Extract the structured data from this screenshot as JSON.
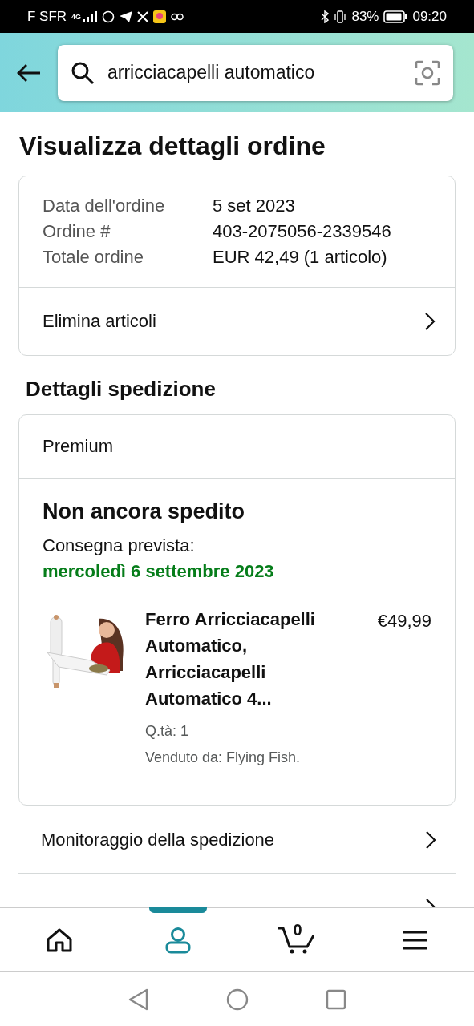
{
  "status_bar": {
    "carrier": "F SFR",
    "network": "4G",
    "battery": "83%",
    "time": "09:20"
  },
  "search": {
    "value": "arricciacapelli automatico"
  },
  "title": "Visualizza dettagli ordine",
  "order": {
    "fields": [
      {
        "label": "Data dell'ordine",
        "value": "5 set 2023"
      },
      {
        "label": "Ordine #",
        "value": "403-2075056-2339546"
      },
      {
        "label": "Totale ordine",
        "value": "EUR 42,49 (1 articolo)"
      }
    ],
    "action": "Elimina articoli"
  },
  "shipping": {
    "heading": "Dettagli spedizione",
    "service": "Premium",
    "status": "Non ancora spedito",
    "delivery_label": "Consegna prevista:",
    "delivery_date": "mercoledì 6 settembre 2023",
    "item": {
      "kind": "picture",
      "name": "Ferro Arricciacapelli Automatico, Arricciacapelli Automatico 4...",
      "price": "€49,99",
      "quantity": "Q.tà: 1",
      "seller": "Venduto da: Flying Fish."
    }
  },
  "links": [
    "Monitoraggio della spedizione"
  ],
  "bottom_nav": [
    {
      "kind": "home",
      "selected": false
    },
    {
      "kind": "account",
      "selected": true
    },
    {
      "kind": "cart",
      "selected": false,
      "count": "0"
    },
    {
      "kind": "menu",
      "selected": false
    }
  ]
}
